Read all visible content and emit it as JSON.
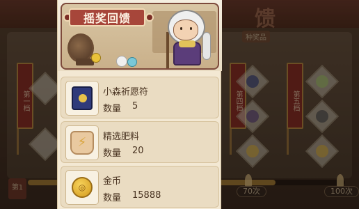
{
  "background": {
    "top_title": "馈",
    "banners": [
      "第一档",
      "第四档",
      "第五档"
    ],
    "tag": "种奖品",
    "prices": [
      "70次",
      "100次"
    ],
    "level_label": "第1",
    "progress_fraction": 0.78
  },
  "popup": {
    "hero_title": "摇奖回馈"
  },
  "rewards": [
    {
      "name": "小森祈愿符",
      "qty_label": "数量",
      "qty": "5",
      "icon": "charm-icon"
    },
    {
      "name": "精选肥料",
      "qty_label": "数量",
      "qty": "20",
      "icon": "fertilizer-icon"
    },
    {
      "name": "金币",
      "qty_label": "数量",
      "qty": "15888",
      "icon": "coin-icon"
    }
  ],
  "colors": {
    "popup_bg": "#f3e8d3",
    "row_bg": "#eadcc2",
    "title_red": "#a7463a",
    "text_brown": "#4a3422"
  }
}
